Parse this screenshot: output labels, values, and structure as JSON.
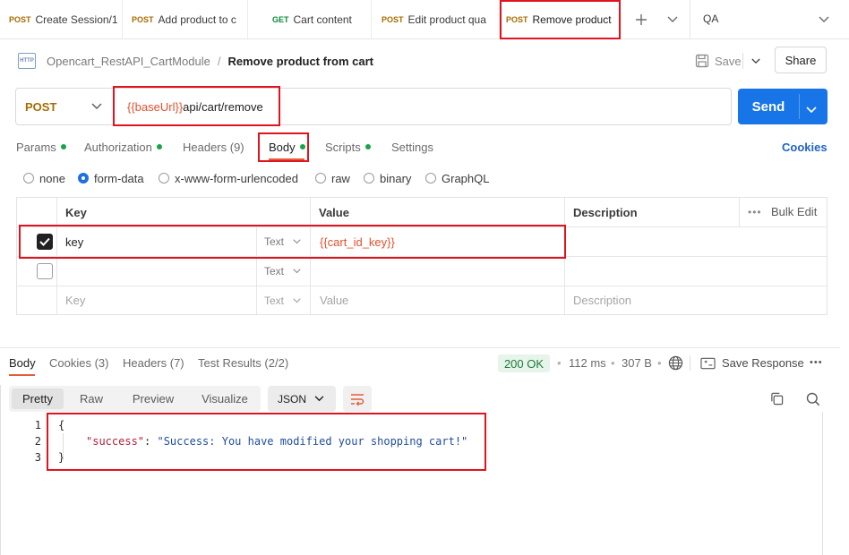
{
  "tabs": [
    {
      "method": "POST",
      "name": "Create Session/1"
    },
    {
      "method": "POST",
      "name": "Add product to c"
    },
    {
      "method": "GET",
      "name": "Cart content"
    },
    {
      "method": "POST",
      "name": "Edit product qua"
    },
    {
      "method": "POST",
      "name": "Remove product"
    }
  ],
  "environment": "QA",
  "icons": {
    "add_tab": "plus-icon",
    "tab_menu": "chevron-down-icon"
  },
  "breadcrumb": {
    "icon_label": "HTTP",
    "collection": "Opencart_RestAPI_CartModule",
    "separator": "/",
    "request": "Remove product from cart"
  },
  "header_actions": {
    "save_label": "Save",
    "share_label": "Share"
  },
  "request": {
    "method": "POST",
    "url_variable": "{{baseUrl}}",
    "url_path": "api/cart/remove",
    "send_label": "Send"
  },
  "request_tabs": [
    {
      "label": "Params",
      "dot": true
    },
    {
      "label": "Authorization",
      "dot": true
    },
    {
      "label": "Headers (9)",
      "dot": false
    },
    {
      "label": "Body",
      "dot": true
    },
    {
      "label": "Scripts",
      "dot": true
    },
    {
      "label": "Settings",
      "dot": false
    }
  ],
  "cookies_link": "Cookies",
  "body_types": [
    "none",
    "form-data",
    "x-www-form-urlencoded",
    "raw",
    "binary",
    "GraphQL"
  ],
  "body_type_selected": "form-data",
  "form_table": {
    "headers": {
      "key": "Key",
      "value": "Value",
      "description": "Description",
      "bulk_edit": "Bulk Edit"
    },
    "rows": [
      {
        "checked": true,
        "key": "key",
        "type": "Text",
        "value": "{{cart_id_key}}",
        "description": ""
      },
      {
        "checked": false,
        "key": "",
        "type": "Text",
        "value": "",
        "description": ""
      }
    ],
    "placeholder_row": {
      "key": "Key",
      "type": "Text",
      "value": "Value",
      "description": "Description"
    }
  },
  "response": {
    "tabs": [
      "Body",
      "Cookies (3)",
      "Headers (7)",
      "Test Results (2/2)"
    ],
    "status": "200 OK",
    "time": "112 ms",
    "size": "307 B",
    "save_response_label": "Save Response",
    "view_modes": [
      "Pretty",
      "Raw",
      "Preview",
      "Visualize"
    ],
    "view_selected": "Pretty",
    "format": "JSON",
    "lines": [
      "1",
      "2",
      "3"
    ],
    "json": {
      "open": "{",
      "key": "\"success\"",
      "colon": ": ",
      "value": "\"Success: You have modified your shopping cart!\"",
      "close": "}"
    }
  }
}
